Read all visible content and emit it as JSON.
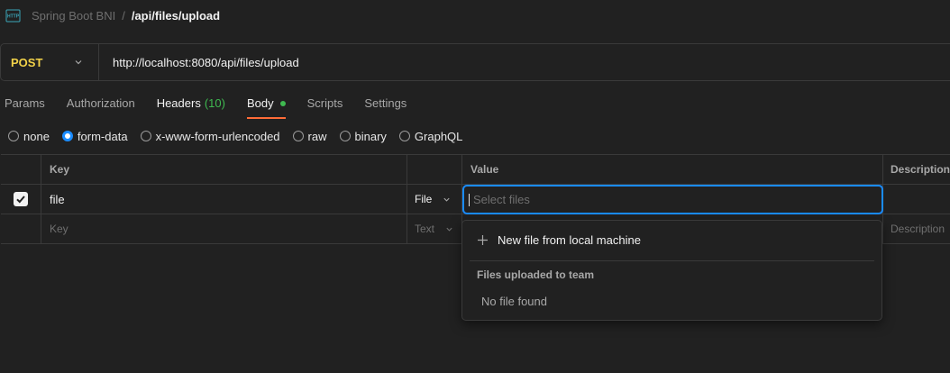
{
  "breadcrumb": {
    "icon": "http-icon",
    "parent": "Spring Boot BNI",
    "separator": "/",
    "current": "/api/files/upload"
  },
  "request": {
    "method": "POST",
    "url": "http://localhost:8080/api/files/upload"
  },
  "tabs": [
    {
      "label": "Params"
    },
    {
      "label": "Authorization"
    },
    {
      "label": "Headers",
      "count": "(10)"
    },
    {
      "label": "Body"
    },
    {
      "label": "Scripts"
    },
    {
      "label": "Settings"
    }
  ],
  "body_types": [
    {
      "label": "none",
      "checked": false
    },
    {
      "label": "form-data",
      "checked": true
    },
    {
      "label": "x-www-form-urlencoded",
      "checked": false
    },
    {
      "label": "raw",
      "checked": false
    },
    {
      "label": "binary",
      "checked": false
    },
    {
      "label": "GraphQL",
      "checked": false
    }
  ],
  "table": {
    "headers": {
      "key": "Key",
      "value": "Value",
      "description": "Description"
    },
    "rows": [
      {
        "key": "file",
        "type": "File",
        "value_placeholder": "Select files"
      },
      {
        "key_placeholder": "Key",
        "type": "Text",
        "description_placeholder": "Description"
      }
    ]
  },
  "dropdown": {
    "new_file": "New file from local machine",
    "section": "Files uploaded to team",
    "empty": "No file found"
  },
  "colors": {
    "accent": "#1a8cff",
    "method": "#f2d249",
    "active_tab": "#ff6c37",
    "success": "#3fb950"
  }
}
